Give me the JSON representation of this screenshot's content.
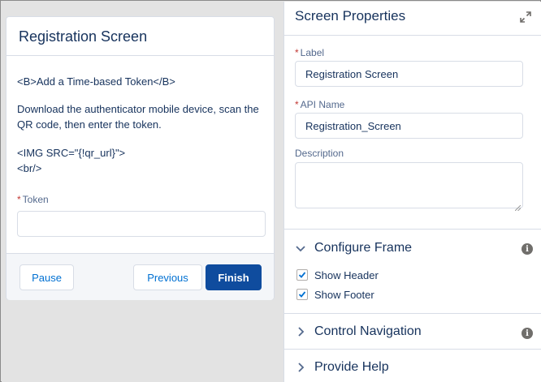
{
  "preview": {
    "title": "Registration Screen",
    "line1": "<B>Add a Time-based Token</B>",
    "line2": "Download the authenticator mobile device, scan the QR code, then enter the token.",
    "line3": "<IMG SRC=\"{!qr_url}\">",
    "line4": "<br/>",
    "token_required": "*",
    "token_label": "Token",
    "token_value": "",
    "buttons": {
      "pause": "Pause",
      "previous": "Previous",
      "finish": "Finish"
    }
  },
  "properties": {
    "title": "Screen Properties",
    "label": {
      "required": "*",
      "text": "Label",
      "value": "Registration Screen"
    },
    "api_name": {
      "required": "*",
      "text": "API Name",
      "value": "Registration_Screen"
    },
    "description": {
      "text": "Description",
      "value": ""
    },
    "sections": {
      "configure_frame": {
        "title": "Configure Frame",
        "state": "expanded",
        "show_header": {
          "label": "Show Header",
          "checked": true
        },
        "show_footer": {
          "label": "Show Footer",
          "checked": true
        }
      },
      "control_navigation": {
        "title": "Control Navigation",
        "state": "collapsed"
      },
      "provide_help": {
        "title": "Provide Help",
        "state": "collapsed"
      }
    },
    "info_glyph": "i"
  },
  "colors": {
    "brand_button": "#0f4c9e",
    "link_blue": "#0070d2",
    "text_dark": "#16325c",
    "required_red": "#c23934",
    "canvas_bg": "#e3e3e3"
  }
}
